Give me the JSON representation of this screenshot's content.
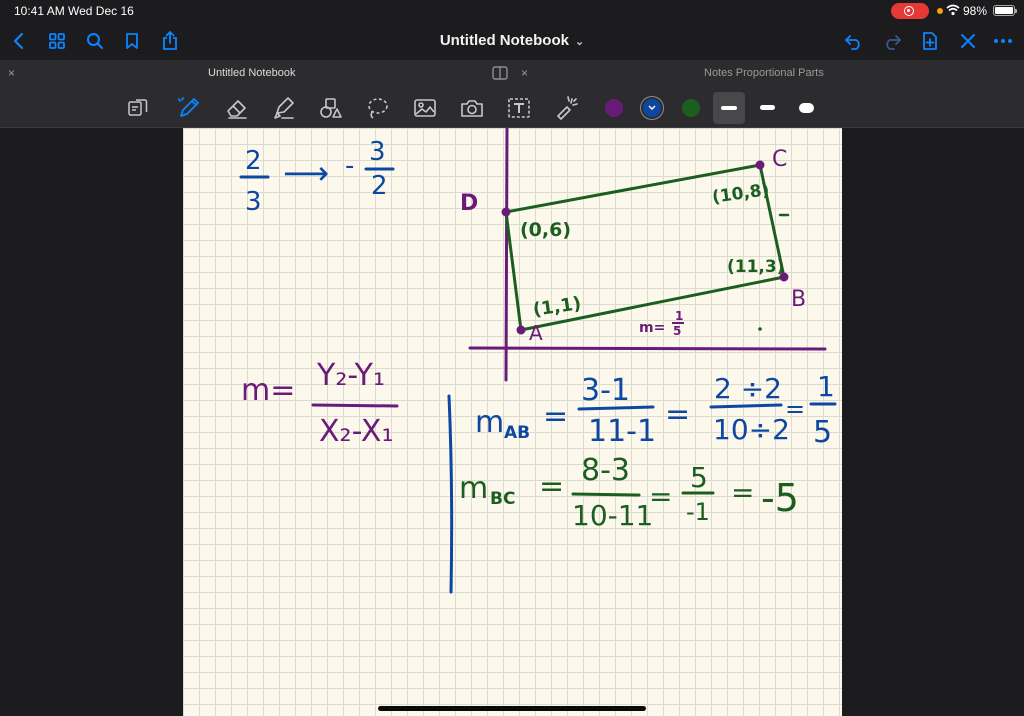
{
  "status": {
    "time": "10:41 AM",
    "date": "Wed Dec 16",
    "battery": "98%",
    "battery_level": 0.98
  },
  "nav": {
    "title": "Untitled Notebook",
    "title_chevron": "⌄"
  },
  "tabs": [
    {
      "label": "Untitled Notebook",
      "active": true
    },
    {
      "label": "Notes Proportional Parts",
      "active": false
    }
  ],
  "tab_close": "×",
  "colors": {
    "purple": "#6a1b7a",
    "blue": "#0d47a1",
    "green": "#1b5e20",
    "accent": "#0a84ff"
  },
  "notes": {
    "fraction_top_num": "2",
    "fraction_top_den": "3",
    "arrow": "⟶",
    "neg_num": "3",
    "neg_den": "2",
    "minus": "-",
    "labels": {
      "d": "D",
      "c": "C",
      "b": "B",
      "a": "A"
    },
    "coords": {
      "p06": "(0,6)",
      "p108": "(10,8)",
      "p113": "(11,3)",
      "p11": "(1,1)"
    },
    "slope_label": "m=",
    "slope_frac_num": "1",
    "slope_frac_den": "5",
    "formula_m": "m=",
    "formula_num": "Y₂-Y₁",
    "formula_den": "X₂-X₁",
    "mab": {
      "m": "m",
      "sub": "AB",
      "eq": "=",
      "num": "3-1",
      "den": "11-1",
      "eq2": "=",
      "num2": "2 ÷2",
      "den2": "10÷2",
      "eq3": "=",
      "num3": "1",
      "den3": "5"
    },
    "mbc": {
      "m": "m",
      "sub": "BC",
      "eq": "=",
      "num": "8-3",
      "den": "10-11",
      "eq2": "=",
      "num2": "5",
      "den2": "-1",
      "eq3": "=",
      "result": "-5"
    }
  }
}
